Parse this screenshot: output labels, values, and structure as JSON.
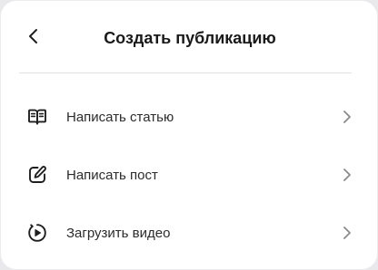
{
  "header": {
    "title": "Создать публикацию",
    "back_icon": "chevron-left-icon"
  },
  "menu": {
    "items": [
      {
        "label": "Написать статью",
        "icon": "open-book-icon",
        "trailing_icon": "chevron-right-icon"
      },
      {
        "label": "Написать пост",
        "icon": "pen-edit-icon",
        "trailing_icon": "chevron-right-icon"
      },
      {
        "label": "Загрузить видео",
        "icon": "video-play-icon",
        "trailing_icon": "chevron-right-icon"
      }
    ]
  },
  "colors": {
    "background": "#ffffff",
    "text": "#1a1a1a",
    "icon": "#1f1f1f",
    "chevron": "#8a8a8f",
    "divider": "#e2e2e6"
  }
}
